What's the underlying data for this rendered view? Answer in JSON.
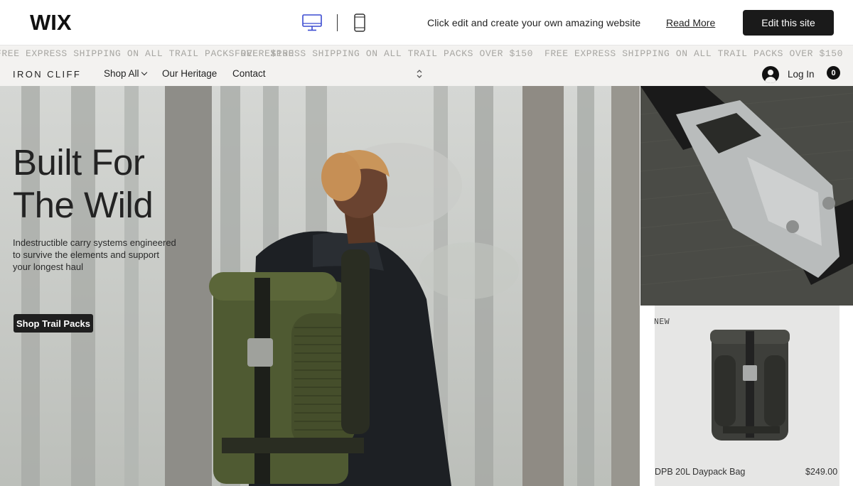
{
  "wix_bar": {
    "logo": "WIX",
    "promo_text": "Click edit and create your own amazing website",
    "read_more": "Read More",
    "edit_button": "Edit this site",
    "desktop_icon": "desktop-monitor-icon",
    "mobile_icon": "mobile-phone-icon"
  },
  "marquee": {
    "text": "FREE EXPRESS SHIPPING ON ALL TRAIL PACKS OVER $150"
  },
  "header": {
    "brand": "IRON CLIFF",
    "nav": {
      "shop_all": "Shop All",
      "heritage": "Our Heritage",
      "contact": "Contact"
    },
    "login": "Log In",
    "cart_count": "0"
  },
  "hero": {
    "title_line1": "Built For",
    "title_line2": "The Wild",
    "subtitle": "Indestructible carry systems engineered to survive the elements and support your longest haul",
    "button": "Shop Trail Packs"
  },
  "product": {
    "badge": "NEW",
    "name": "DPB 20L Daypack Bag",
    "price": "$249.00"
  },
  "colors": {
    "dark_button": "#1a1a1a",
    "header_bg": "#f3f2f0",
    "marquee_text": "#a7a6a2",
    "backpack_green": "#4f5a32"
  }
}
